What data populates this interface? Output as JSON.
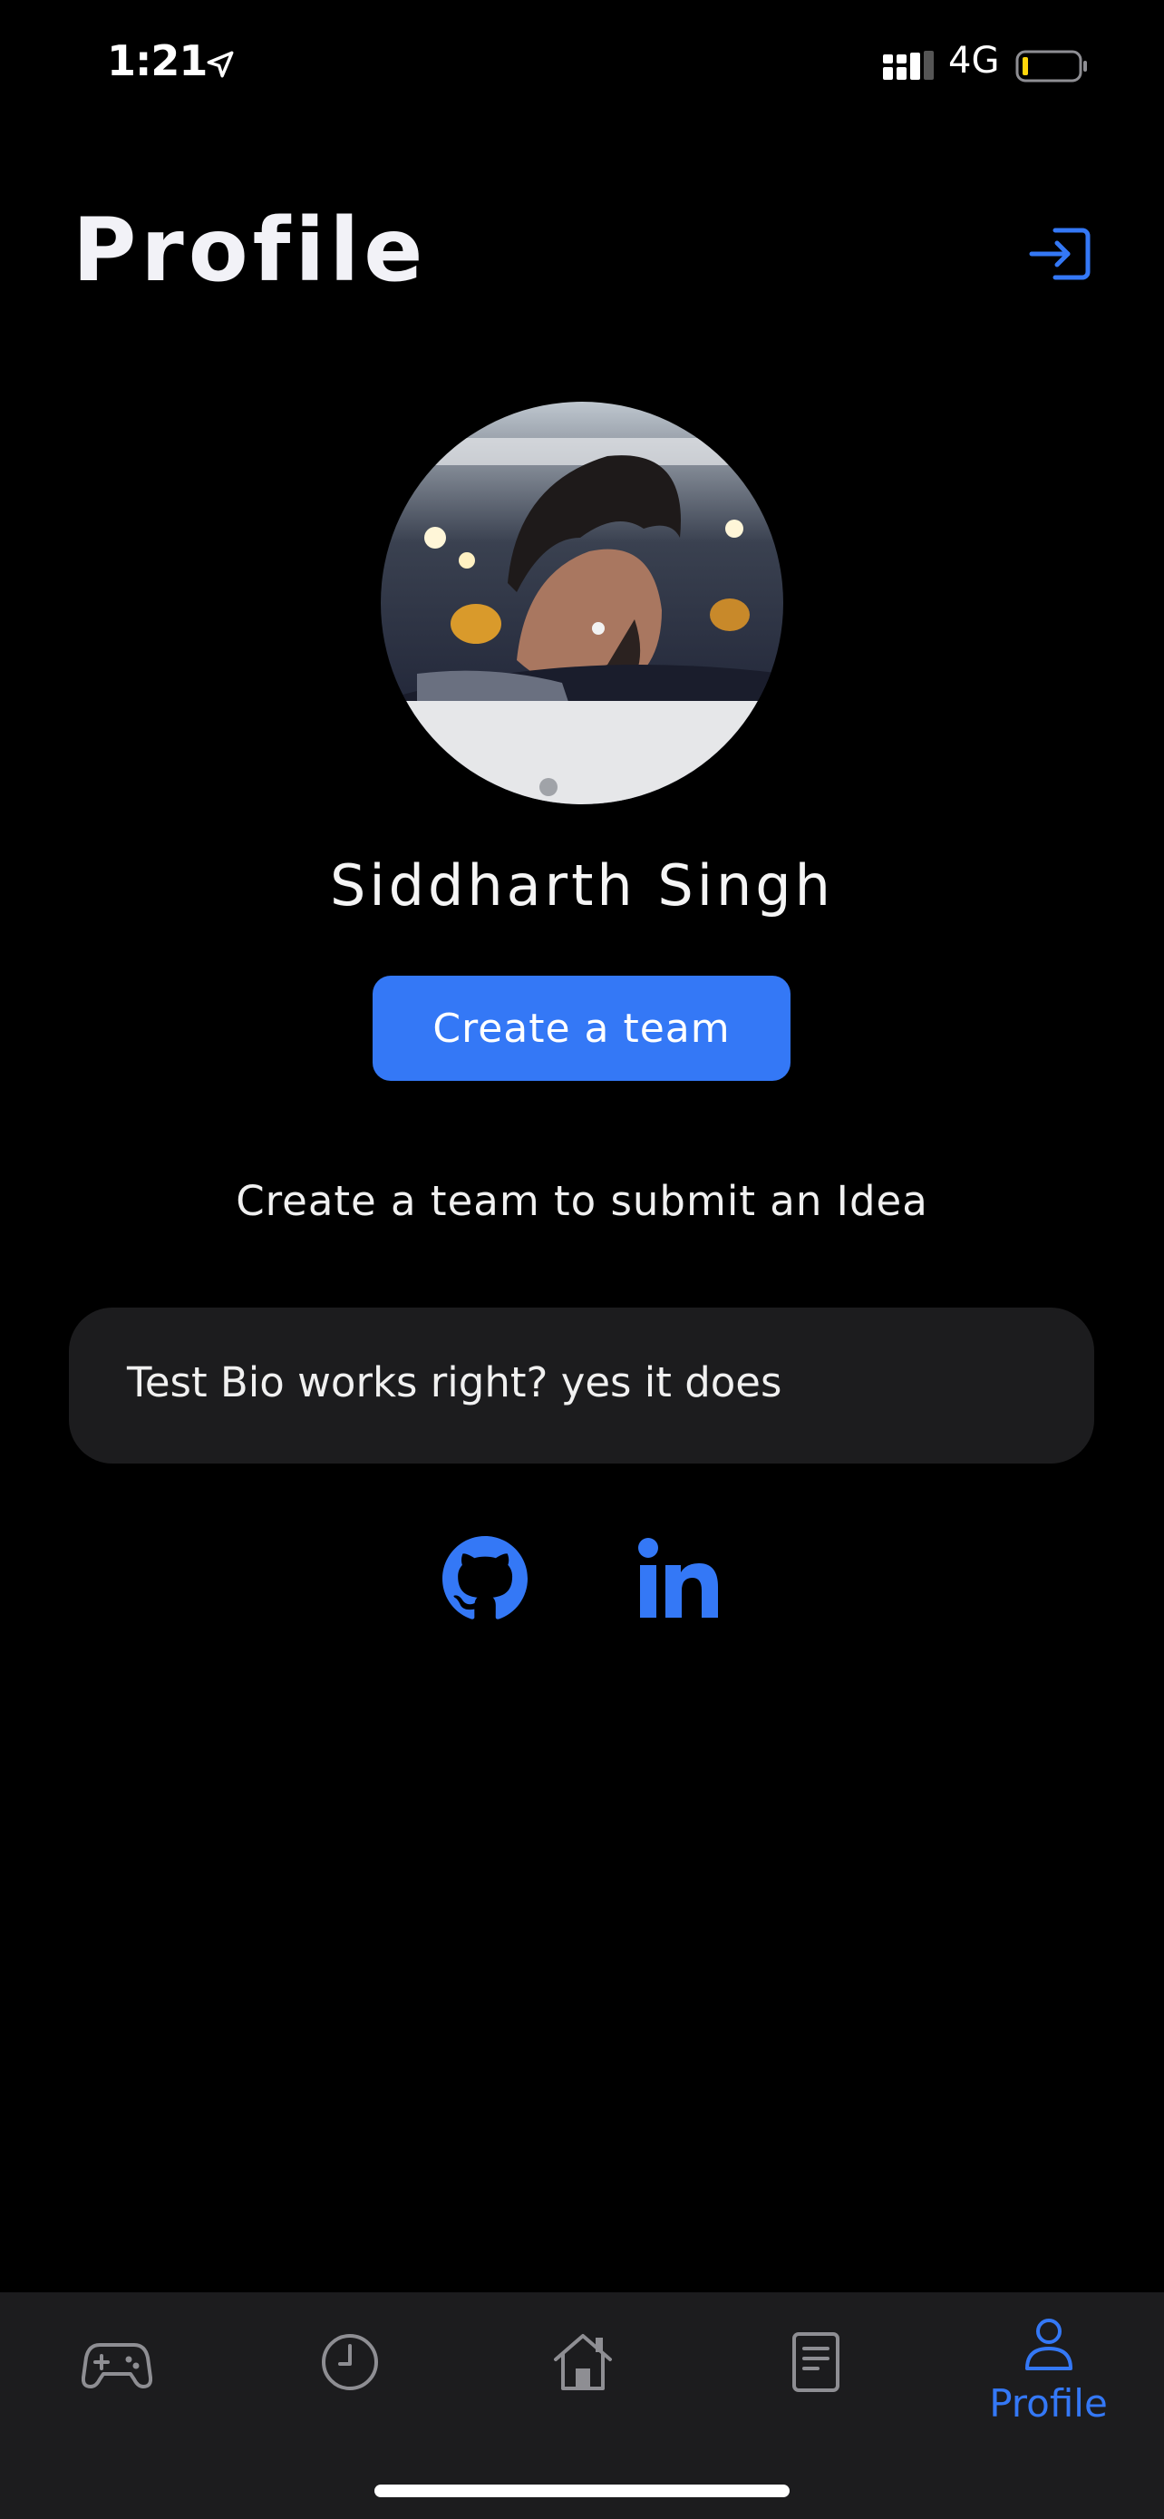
{
  "status_bar": {
    "time": "1:21",
    "network": "4G"
  },
  "header": {
    "title": "Profile",
    "logout_icon": "login-arrow-icon"
  },
  "profile": {
    "name": "Siddharth Singh",
    "avatar": "profile-photo",
    "create_team_label": "Create a team",
    "team_hint": "Create a team to submit an Idea",
    "bio": "Test Bio works right? yes it does",
    "social_links": [
      "github-icon",
      "linkedin-icon"
    ]
  },
  "tab_bar": {
    "active_label": "Profile",
    "tabs": [
      "gamepad-icon",
      "clock-icon",
      "home-icon",
      "document-icon",
      "person-icon"
    ]
  },
  "colors": {
    "accent": "#3478f6",
    "background": "#000000",
    "card": "#1c1c1e",
    "inactive_tab": "#8e8e93",
    "battery_low": "#ffd60a"
  }
}
